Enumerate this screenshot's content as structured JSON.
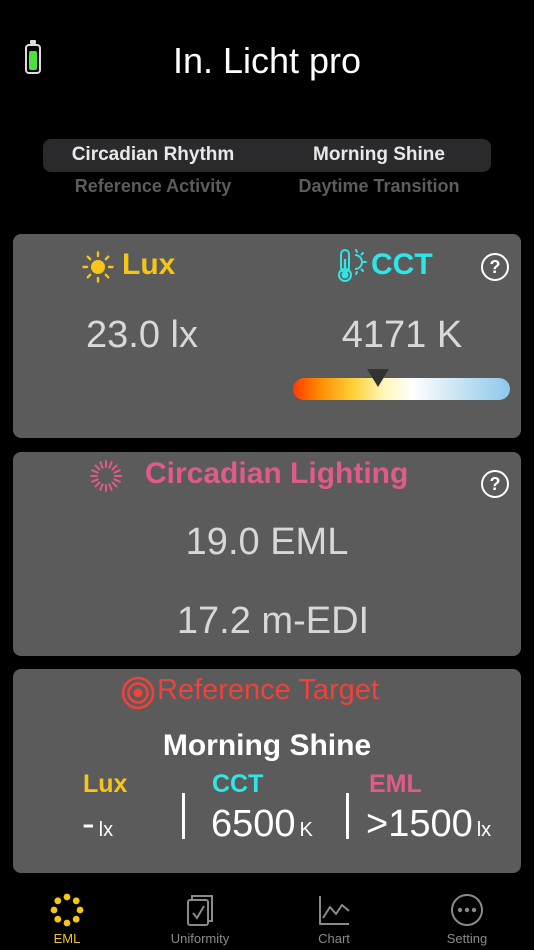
{
  "app": {
    "title": "In. Licht pro"
  },
  "mode_picker": {
    "selected": [
      "Circadian Rhythm",
      "Morning Shine"
    ],
    "next": [
      "Reference Activity",
      "Daytime Transition"
    ]
  },
  "lux_card": {
    "lux_label": "Lux",
    "lux_value": "23.0 lx",
    "cct_label": "CCT",
    "cct_value": "4171 K",
    "help": "?"
  },
  "circadian_card": {
    "title": "Circadian Lighting",
    "eml_value": "19.0 EML",
    "medi_value": "17.2 m-EDI",
    "help": "?"
  },
  "target_card": {
    "title": "Reference Target",
    "name": "Morning Shine",
    "lux_label": "Lux",
    "lux_value": "-",
    "lux_unit": "lx",
    "cct_label": "CCT",
    "cct_value": "6500",
    "cct_unit": "K",
    "eml_label": "EML",
    "eml_value": ">1500",
    "eml_unit": "lx"
  },
  "tabs": [
    {
      "label": "EML",
      "icon": "eml-icon",
      "active": true
    },
    {
      "label": "Uniformity",
      "icon": "uniformity-icon",
      "active": false
    },
    {
      "label": "Chart",
      "icon": "chart-icon",
      "active": false
    },
    {
      "label": "Setting",
      "icon": "setting-icon",
      "active": false
    }
  ],
  "colors": {
    "lux": "#f5c518",
    "cct": "#2fe6e6",
    "eml": "#e05a8c",
    "target": "#f0413a",
    "card": "#5b5b5b"
  },
  "cct_scale": {
    "value_k": 4171,
    "marker_fraction": 0.39
  }
}
